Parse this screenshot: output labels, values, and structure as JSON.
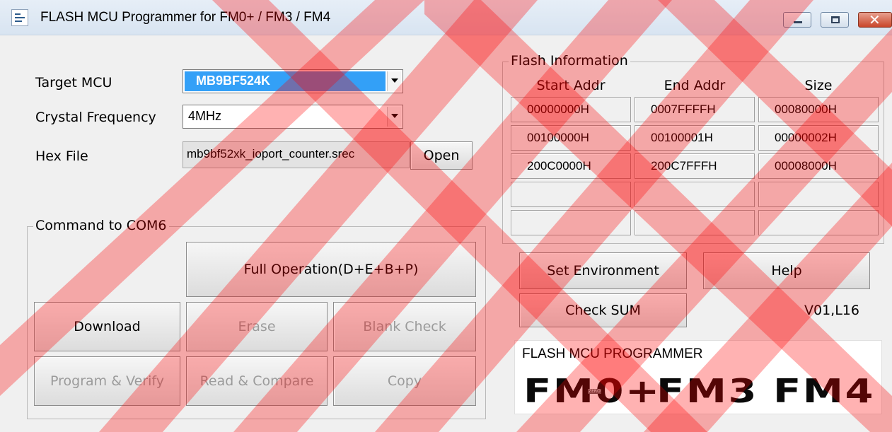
{
  "window": {
    "title": "FLASH MCU Programmer for FM0+ / FM3 / FM4"
  },
  "form": {
    "target_mcu_label": "Target MCU",
    "target_mcu_value": "MB9BF524K",
    "crystal_label": "Crystal Frequency",
    "crystal_value": "4MHz",
    "hex_label": "Hex File",
    "hex_value": "mb9bf52xk_ioport_counter.srec",
    "open_label": "Open"
  },
  "command_group": {
    "title": "Command to COM6",
    "full_operation": "Full Operation(D+E+B+P)",
    "download": "Download",
    "erase": "Erase",
    "blank_check": "Blank Check",
    "program_verify": "Program & Verify",
    "read_compare": "Read & Compare",
    "copy": "Copy"
  },
  "flash_info": {
    "title": "Flash Information",
    "headers": [
      "Start Addr",
      "End Addr",
      "Size"
    ],
    "rows": [
      [
        "00000000H",
        "0007FFFFH",
        "00080000H"
      ],
      [
        "00100000H",
        "00100001H",
        "00000002H"
      ],
      [
        "200C0000H",
        "200C7FFFH",
        "00008000H"
      ],
      [
        "",
        "",
        ""
      ],
      [
        "",
        "",
        ""
      ]
    ]
  },
  "actions": {
    "set_environment": "Set Environment",
    "help": "Help",
    "check_sum": "Check SUM",
    "version": "V01,L16"
  },
  "logo": {
    "caption": "FLASH MCU PROGRAMMER",
    "words": [
      "FM0+",
      "FM3",
      "FM4"
    ],
    "zero_mark": "ZERO"
  },
  "colors": {
    "selection": "#33a0f7",
    "watermark": "#ff0000"
  }
}
